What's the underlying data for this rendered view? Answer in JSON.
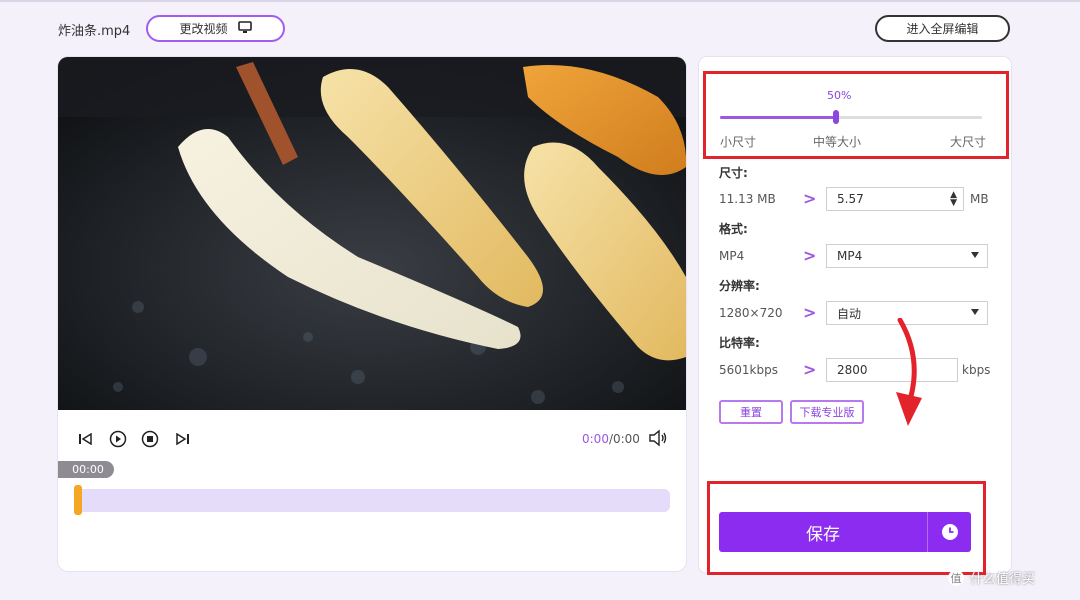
{
  "header": {
    "filename": "炸油条.mp4",
    "change_video_label": "更改视频",
    "fullscreen_edit_label": "进入全屏编辑"
  },
  "player": {
    "current_time": "0:00",
    "total_time": "/0:00",
    "time_bubble": "00:00",
    "progress": 0
  },
  "compression": {
    "percent_label": "50%",
    "slider_value": 0.5,
    "small_label": "小尺寸",
    "medium_label": "中等大小",
    "large_label": "大尺寸"
  },
  "settings": {
    "size_title": "尺寸:",
    "size_original": "11.13 MB",
    "size_value": "5.57",
    "size_unit": "MB",
    "format_title": "格式:",
    "format_original": "MP4",
    "format_value": "MP4",
    "resolution_title": "分辨率:",
    "resolution_original": "1280×720",
    "resolution_value": "自动",
    "bitrate_title": "比特率:",
    "bitrate_original": "5601kbps",
    "bitrate_value": "2800",
    "bitrate_unit": "kbps",
    "arrow": ">"
  },
  "actions": {
    "reset_label": "重置",
    "download_pro_label": "下载专业版",
    "save_label": "保存"
  },
  "watermark": {
    "logo_text": "值",
    "text": "什么值得买"
  },
  "colors": {
    "accent": "#8c2cf0",
    "highlight_box": "#e3232b",
    "progress_handle": "#f5a623"
  }
}
